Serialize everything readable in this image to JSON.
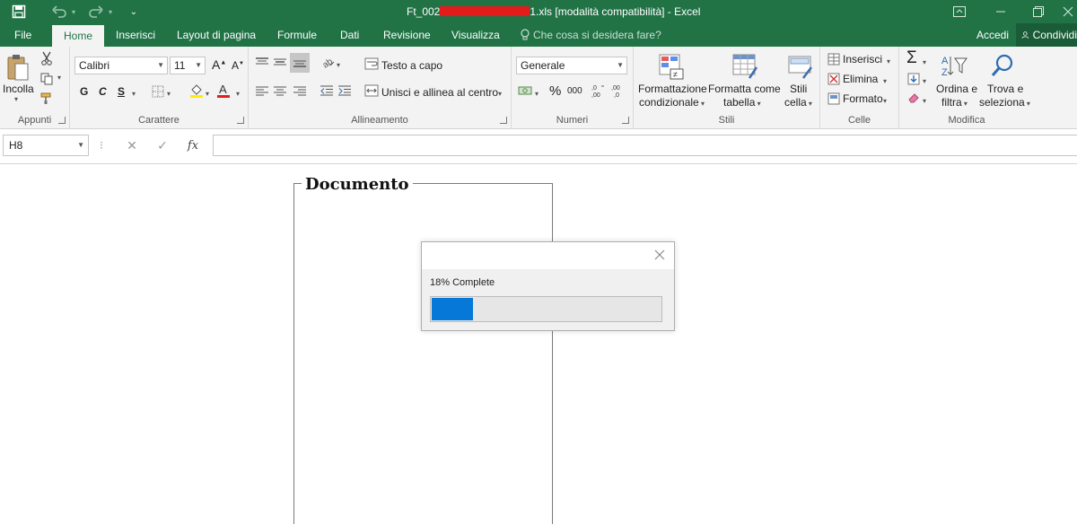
{
  "title_bar": {
    "file_prefix": "Ft_002",
    "file_suffix": "1.xls",
    "mode": "[modalità compatibilità] - Excel"
  },
  "tabs": [
    {
      "label": "File"
    },
    {
      "label": "Home"
    },
    {
      "label": "Inserisci"
    },
    {
      "label": "Layout di pagina"
    },
    {
      "label": "Formule"
    },
    {
      "label": "Dati"
    },
    {
      "label": "Revisione"
    },
    {
      "label": "Visualizza"
    }
  ],
  "tell_me": "Che cosa si desidera fare?",
  "account": {
    "sign_in": "Accedi",
    "share": "Condividi"
  },
  "ribbon": {
    "clipboard": {
      "paste": "Incolla",
      "label": "Appunti"
    },
    "font": {
      "name": "Calibri",
      "size": "11",
      "bold": "G",
      "italic": "C",
      "underline": "S",
      "label": "Carattere"
    },
    "alignment": {
      "wrap": "Testo a capo",
      "merge": "Unisci e allinea al centro",
      "label": "Allineamento"
    },
    "number": {
      "format": "Generale",
      "percent": "%",
      "thousands": "000",
      "label": "Numeri"
    },
    "styles": {
      "conditional_1": "Formattazione",
      "conditional_2": "condizionale",
      "table_1": "Formatta come",
      "table_2": "tabella",
      "cell_1": "Stili",
      "cell_2": "cella",
      "label": "Stili"
    },
    "cells": {
      "insert": "Inserisci",
      "delete": "Elimina",
      "format": "Formato",
      "label": "Celle"
    },
    "editing": {
      "sort_1": "Ordina e",
      "sort_2": "filtra",
      "find_1": "Trova e",
      "find_2": "seleziona",
      "label": "Modifica"
    }
  },
  "formula_bar": {
    "name_box": "H8",
    "fx": "fx",
    "content": ""
  },
  "sheet": {
    "document_title": "Documento"
  },
  "dialog": {
    "progress_text": "18% Complete",
    "progress": 0.18
  },
  "colors": {
    "excel_green": "#217346",
    "progress_blue": "#0678d7",
    "font_red": "#e02020",
    "highlight_yellow": "#ffee00"
  }
}
